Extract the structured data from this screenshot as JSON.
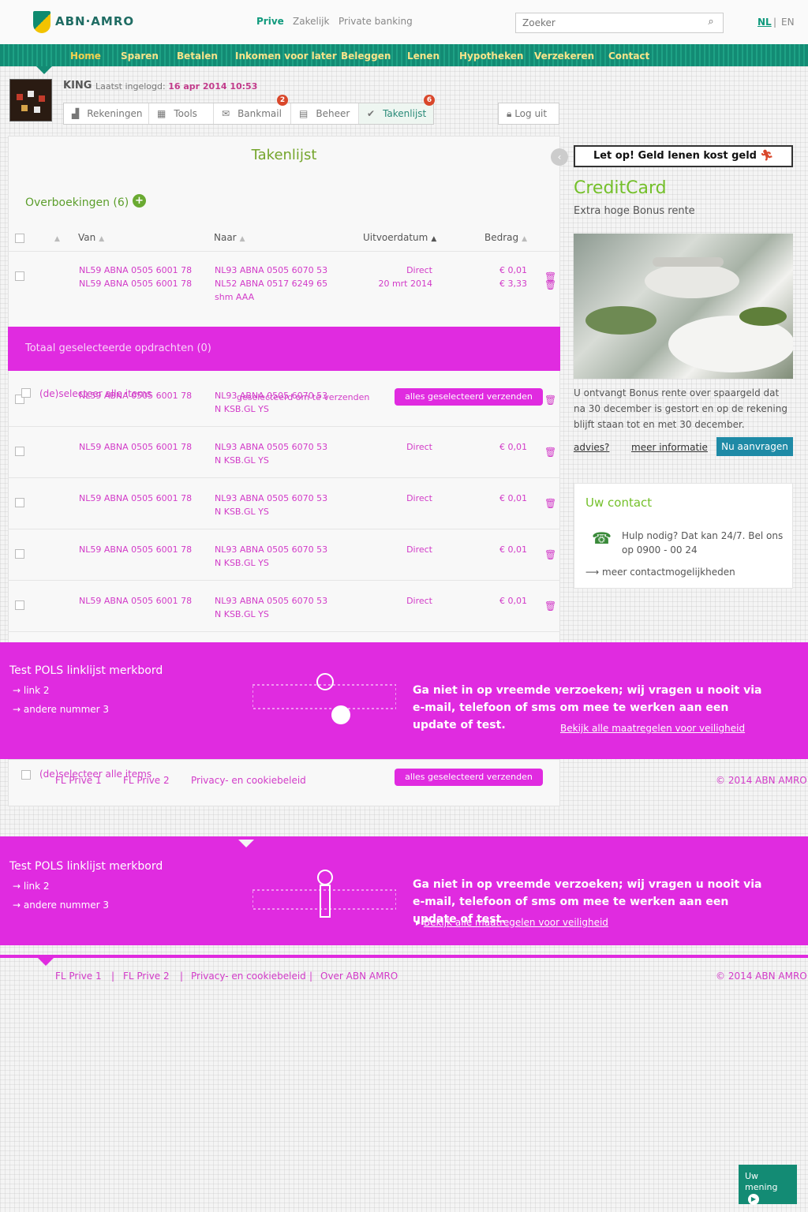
{
  "brand": {
    "name": "ABN·AMRO"
  },
  "segments": [
    "Prive",
    "Zakelijk",
    "Private banking"
  ],
  "search": {
    "placeholder": "Zoeker"
  },
  "languages": [
    "NL",
    "EN"
  ],
  "main_nav": [
    "Home",
    "Sparen",
    "Betalen",
    "Inkomen voor later",
    "Beleggen",
    "Lenen",
    "Hypotheken",
    "Verzekeren",
    "Contact"
  ],
  "user": {
    "name": "KING",
    "last_login_label": "Laatst ingelogd:",
    "last_login_value": "16 apr 2014 10:53"
  },
  "subnav": [
    {
      "label": "Rekeningen",
      "icon": "bar-chart-icon"
    },
    {
      "label": "Tools",
      "icon": "tools-icon"
    },
    {
      "label": "Bankmail",
      "icon": "mail-icon",
      "badge": "2"
    },
    {
      "label": "Beheer",
      "icon": "manage-icon"
    },
    {
      "label": "Takenlijst",
      "icon": "check-icon",
      "badge": "6"
    }
  ],
  "logout": "Log uit",
  "panel": {
    "title": "Takenlijst",
    "section_title": "Overboekingen (6)",
    "columns": {
      "from": "Van",
      "to": "Naar",
      "date": "Uitvoerdatum",
      "amount": "Bedrag"
    },
    "rows": [
      {
        "from": "NL59 ABNA 0505 6001 78",
        "to": "NL93 ABNA 0505 6070 53",
        "date": "Direct",
        "amount": "€ 0,01"
      },
      {
        "from": "NL59 ABNA 0505 6001 78",
        "to": "NL52 ABNA 0517 6249 65",
        "to2": "shm AAA",
        "date": "20 mrt 2014",
        "amount": "€ 3,33"
      },
      {
        "from": "NL59 ABNA 0505 6001 78",
        "to": "NL93 ABNA 0505 6070 53",
        "to2": "N KSB.GL YS",
        "date": "Direct",
        "amount": "€ 0,01"
      },
      {
        "from": "NL59 ABNA 0505 6001 78",
        "to": "NL93 ABNA 0505 6070 53",
        "to2": "N KSB.GL YS",
        "date": "Direct",
        "amount": "€ 0,01"
      },
      {
        "from": "NL59 ABNA 0505 6001 78",
        "to": "NL93 ABNA 0505 6070 53",
        "to2": "N KSB.GL YS",
        "date": "Direct",
        "amount": "€ 0,01"
      },
      {
        "from": "NL59 ABNA 0505 6001 78",
        "to": "NL93 ABNA 0505 6070 53",
        "to2": "N KSB.GL YS",
        "date": "Direct",
        "amount": "€ 0,01"
      },
      {
        "from": "NL59 ABNA 0505 6001 78",
        "to": "NL93 ABNA 0505 6070 53",
        "to2": "N KSB.GL YS",
        "date": "Direct",
        "amount": "€ 0,01"
      }
    ],
    "total_text": "Totaal geselecteerde opdrachten (0)",
    "select_all": "(de)selecteer alle items",
    "overlay_text": "geselecteerd om te verzenden",
    "submit_label": "alles geselecteerd verzenden"
  },
  "promo": {
    "button": "Let op! Geld lenen kost geld",
    "title": "CreditCard",
    "subtitle": "Extra hoge Bonus rente",
    "description": "U ontvangt Bonus rente over spaargeld dat na 30 december is gestort en op de rekening blijft staan tot en met 30 december.",
    "link1": "advies?",
    "link2": "meer informatie",
    "apply": "Nu aanvragen"
  },
  "contact": {
    "title": "Uw contact",
    "text": "Hulp nodig? Dat kan 24/7. Bel ons op 0900 - 00 24",
    "more": "meer contactmogelijkheden"
  },
  "footer": {
    "title": "Test POLS linklijst merkbord",
    "links": [
      "link 2",
      "andere nummer 3"
    ],
    "message": "Ga niet in op vreemde verzoeken; wij vragen u nooit via e-mail, telefoon of sms om mee te werken aan een update of test.",
    "message_link": "Bekijk alle maatregelen voor veiligheid",
    "bottom_links": [
      "FL Prive 1",
      "FL Prive 2",
      "Privacy- en cookiebeleid",
      "Over ABN AMRO"
    ],
    "copyright": "© 2014 ABN AMRO"
  },
  "feedback": "Uw mening"
}
